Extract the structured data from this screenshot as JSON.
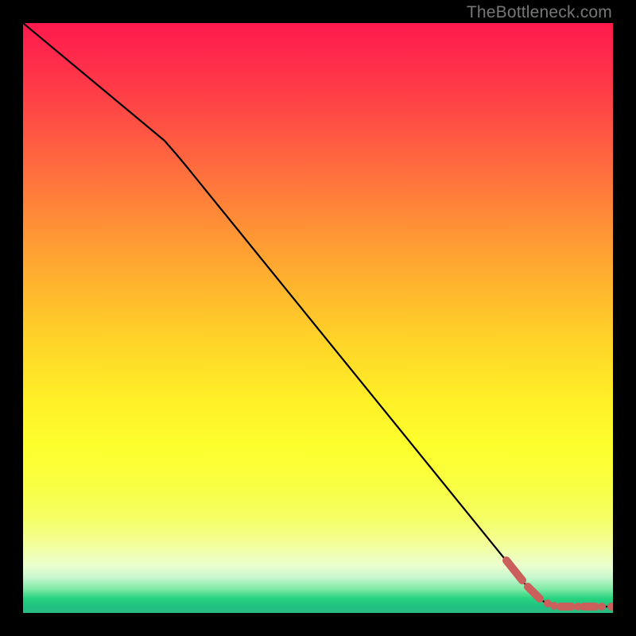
{
  "watermark": "TheBottleneck.com",
  "chart_data": {
    "type": "line",
    "title": "",
    "xlabel": "",
    "ylabel": "",
    "xlim": [
      0,
      100
    ],
    "ylim": [
      0,
      100
    ],
    "series": [
      {
        "name": "curve",
        "style": "solid-black",
        "points": [
          {
            "x": 0,
            "y": 100
          },
          {
            "x": 24,
            "y": 80
          },
          {
            "x": 29,
            "y": 75
          },
          {
            "x": 85,
            "y": 5
          },
          {
            "x": 88,
            "y": 2
          },
          {
            "x": 91,
            "y": 1
          },
          {
            "x": 100,
            "y": 1
          }
        ]
      },
      {
        "name": "highlight-region",
        "style": "thick-dashed-salmon",
        "points": [
          {
            "x": 82,
            "y": 9
          },
          {
            "x": 85,
            "y": 5
          },
          {
            "x": 88,
            "y": 2
          },
          {
            "x": 90,
            "y": 1
          },
          {
            "x": 92,
            "y": 1
          },
          {
            "x": 94,
            "y": 1
          },
          {
            "x": 96,
            "y": 1
          },
          {
            "x": 98,
            "y": 1
          },
          {
            "x": 100,
            "y": 1
          }
        ]
      }
    ],
    "axes_visible": false,
    "grid": false,
    "background": "rainbow-vertical-gradient"
  }
}
